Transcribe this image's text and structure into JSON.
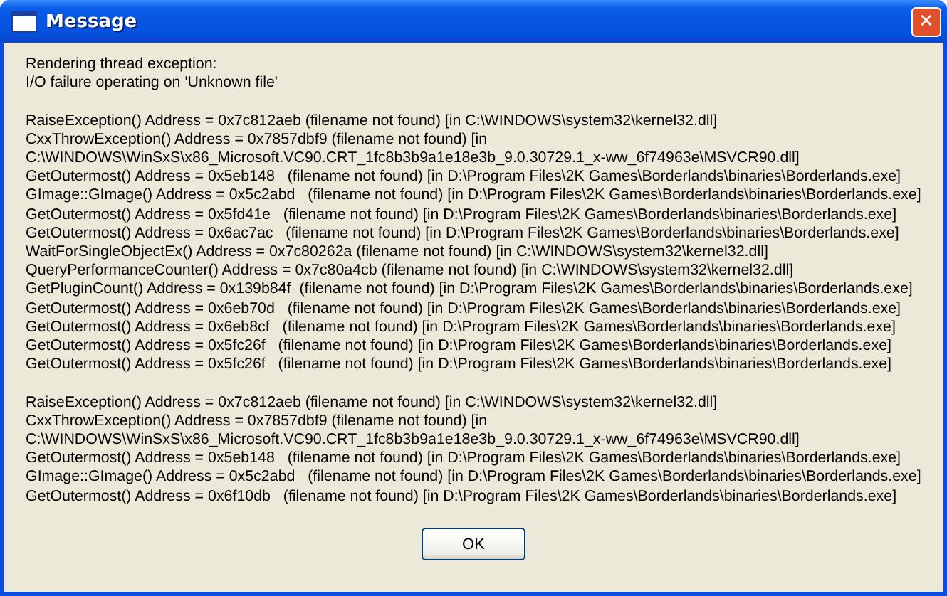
{
  "window": {
    "title": "Message",
    "close_label": "✕"
  },
  "message": {
    "paragraphs": [
      [
        "Rendering thread exception:",
        "I/O failure operating on 'Unknown file'"
      ],
      [
        "RaiseException() Address = 0x7c812aeb (filename not found) [in C:\\WINDOWS\\system32\\kernel32.dll]",
        "CxxThrowException() Address = 0x7857dbf9 (filename not found) [in",
        "C:\\WINDOWS\\WinSxS\\x86_Microsoft.VC90.CRT_1fc8b3b9a1e18e3b_9.0.30729.1_x-ww_6f74963e\\MSVCR90.dll]",
        "GetOutermost() Address = 0x5eb148   (filename not found) [in D:\\Program Files\\2K Games\\Borderlands\\binaries\\Borderlands.exe]",
        "GImage::GImage() Address = 0x5c2abd   (filename not found) [in D:\\Program Files\\2K Games\\Borderlands\\binaries\\Borderlands.exe]",
        "GetOutermost() Address = 0x5fd41e   (filename not found) [in D:\\Program Files\\2K Games\\Borderlands\\binaries\\Borderlands.exe]",
        "GetOutermost() Address = 0x6ac7ac   (filename not found) [in D:\\Program Files\\2K Games\\Borderlands\\binaries\\Borderlands.exe]",
        "WaitForSingleObjectEx() Address = 0x7c80262a (filename not found) [in C:\\WINDOWS\\system32\\kernel32.dll]",
        "QueryPerformanceCounter() Address = 0x7c80a4cb (filename not found) [in C:\\WINDOWS\\system32\\kernel32.dll]",
        "GetPluginCount() Address = 0x139b84f  (filename not found) [in D:\\Program Files\\2K Games\\Borderlands\\binaries\\Borderlands.exe]",
        "GetOutermost() Address = 0x6eb70d   (filename not found) [in D:\\Program Files\\2K Games\\Borderlands\\binaries\\Borderlands.exe]",
        "GetOutermost() Address = 0x6eb8cf   (filename not found) [in D:\\Program Files\\2K Games\\Borderlands\\binaries\\Borderlands.exe]",
        "GetOutermost() Address = 0x5fc26f   (filename not found) [in D:\\Program Files\\2K Games\\Borderlands\\binaries\\Borderlands.exe]",
        "GetOutermost() Address = 0x5fc26f   (filename not found) [in D:\\Program Files\\2K Games\\Borderlands\\binaries\\Borderlands.exe]"
      ],
      [
        "RaiseException() Address = 0x7c812aeb (filename not found) [in C:\\WINDOWS\\system32\\kernel32.dll]",
        "CxxThrowException() Address = 0x7857dbf9 (filename not found) [in",
        "C:\\WINDOWS\\WinSxS\\x86_Microsoft.VC90.CRT_1fc8b3b9a1e18e3b_9.0.30729.1_x-ww_6f74963e\\MSVCR90.dll]",
        "GetOutermost() Address = 0x5eb148   (filename not found) [in D:\\Program Files\\2K Games\\Borderlands\\binaries\\Borderlands.exe]",
        "GImage::GImage() Address = 0x5c2abd   (filename not found) [in D:\\Program Files\\2K Games\\Borderlands\\binaries\\Borderlands.exe]",
        "GetOutermost() Address = 0x6f10db   (filename not found) [in D:\\Program Files\\2K Games\\Borderlands\\binaries\\Borderlands.exe]"
      ]
    ]
  },
  "buttons": [
    "OK"
  ]
}
